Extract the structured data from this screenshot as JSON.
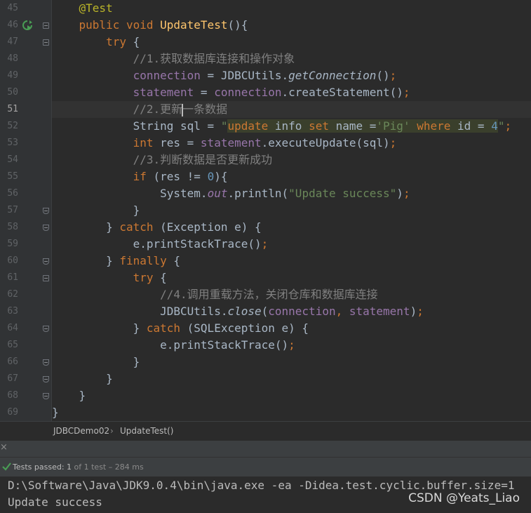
{
  "editor": {
    "current_line": "51",
    "lines": [
      {
        "n": "45",
        "parts": [
          [
            "    ",
            ""
          ],
          [
            "@Test",
            "ann"
          ]
        ]
      },
      {
        "n": "46",
        "parts": [
          [
            "    ",
            ""
          ],
          [
            "public void ",
            "kw"
          ],
          [
            "UpdateTest",
            "fn"
          ],
          [
            "(){",
            ""
          ]
        ]
      },
      {
        "n": "47",
        "parts": [
          [
            "        ",
            ""
          ],
          [
            "try ",
            "kw"
          ],
          [
            "{",
            ""
          ]
        ]
      },
      {
        "n": "48",
        "parts": [
          [
            "            ",
            ""
          ],
          [
            "//1.获取数据库连接和操作对象",
            "cmt"
          ]
        ]
      },
      {
        "n": "49",
        "parts": [
          [
            "            ",
            ""
          ],
          [
            "connection",
            "fld"
          ],
          [
            " = JDBCUtils.",
            ""
          ],
          [
            "getConnection",
            "it"
          ],
          [
            "()",
            ""
          ],
          [
            ";",
            "kw"
          ]
        ]
      },
      {
        "n": "50",
        "parts": [
          [
            "            ",
            ""
          ],
          [
            "statement",
            "fld"
          ],
          [
            " = ",
            ""
          ],
          [
            "connection",
            "fld"
          ],
          [
            ".createStatement()",
            ""
          ],
          [
            ";",
            "kw"
          ]
        ]
      },
      {
        "n": "51",
        "parts": [
          [
            "            ",
            ""
          ],
          [
            "//2.更新",
            "cmt"
          ],
          [
            "",
            "caret"
          ],
          [
            "一条数据",
            "cmt"
          ]
        ]
      },
      {
        "n": "52",
        "parts": [
          [
            "            ",
            ""
          ],
          [
            "String sql = ",
            ""
          ],
          [
            "\"",
            "str"
          ],
          [
            "update",
            "kw hl"
          ],
          [
            " info ",
            "hl"
          ],
          [
            "set",
            "kw hl"
          ],
          [
            " name =",
            "hl"
          ],
          [
            "'Pig'",
            "str hl"
          ],
          [
            " ",
            "hl"
          ],
          [
            "where",
            "kw hl"
          ],
          [
            " id = ",
            "hl"
          ],
          [
            "4",
            "num hl"
          ],
          [
            "\"",
            "str"
          ],
          [
            ";",
            "kw"
          ]
        ]
      },
      {
        "n": "53",
        "parts": [
          [
            "            ",
            ""
          ],
          [
            "int ",
            "kw"
          ],
          [
            "res = ",
            ""
          ],
          [
            "statement",
            "fld"
          ],
          [
            ".executeUpdate(sql)",
            ""
          ],
          [
            ";",
            "kw"
          ]
        ]
      },
      {
        "n": "54",
        "parts": [
          [
            "            ",
            ""
          ],
          [
            "//3.判断数据是否更新成功",
            "cmt"
          ]
        ]
      },
      {
        "n": "55",
        "parts": [
          [
            "            ",
            ""
          ],
          [
            "if ",
            "kw"
          ],
          [
            "(res != ",
            ""
          ],
          [
            "0",
            "num"
          ],
          [
            "){",
            ""
          ]
        ]
      },
      {
        "n": "56",
        "parts": [
          [
            "                ",
            ""
          ],
          [
            "System.",
            ""
          ],
          [
            "out",
            "fld it"
          ],
          [
            ".println(",
            ""
          ],
          [
            "\"Update success\"",
            "str"
          ],
          [
            ")",
            ""
          ],
          [
            ";",
            "kw"
          ]
        ]
      },
      {
        "n": "57",
        "parts": [
          [
            "            ",
            ""
          ],
          [
            "}",
            ""
          ]
        ]
      },
      {
        "n": "58",
        "parts": [
          [
            "        ",
            ""
          ],
          [
            "} ",
            ""
          ],
          [
            "catch ",
            "kw"
          ],
          [
            "(Exception e) {",
            ""
          ]
        ]
      },
      {
        "n": "59",
        "parts": [
          [
            "            ",
            ""
          ],
          [
            "e.printStackTrace()",
            ""
          ],
          [
            ";",
            "kw"
          ]
        ]
      },
      {
        "n": "60",
        "parts": [
          [
            "        ",
            ""
          ],
          [
            "} ",
            ""
          ],
          [
            "finally ",
            "kw"
          ],
          [
            "{",
            ""
          ]
        ]
      },
      {
        "n": "61",
        "parts": [
          [
            "            ",
            ""
          ],
          [
            "try ",
            "kw"
          ],
          [
            "{",
            ""
          ]
        ]
      },
      {
        "n": "62",
        "parts": [
          [
            "                ",
            ""
          ],
          [
            "//4.调用重载方法，关闭仓库和数据库连接",
            "cmt"
          ]
        ]
      },
      {
        "n": "63",
        "parts": [
          [
            "                ",
            ""
          ],
          [
            "JDBCUtils.",
            ""
          ],
          [
            "close",
            "it"
          ],
          [
            "(",
            ""
          ],
          [
            "connection",
            "fld"
          ],
          [
            ", ",
            "kw"
          ],
          [
            "statement",
            "fld"
          ],
          [
            ")",
            ""
          ],
          [
            ";",
            "kw"
          ]
        ]
      },
      {
        "n": "64",
        "parts": [
          [
            "            ",
            ""
          ],
          [
            "} ",
            ""
          ],
          [
            "catch ",
            "kw"
          ],
          [
            "(SQLException e) {",
            ""
          ]
        ]
      },
      {
        "n": "65",
        "parts": [
          [
            "                ",
            ""
          ],
          [
            "e.printStackTrace()",
            ""
          ],
          [
            ";",
            "kw"
          ]
        ]
      },
      {
        "n": "66",
        "parts": [
          [
            "            ",
            ""
          ],
          [
            "}",
            ""
          ]
        ]
      },
      {
        "n": "67",
        "parts": [
          [
            "        ",
            ""
          ],
          [
            "}",
            ""
          ]
        ]
      },
      {
        "n": "68",
        "parts": [
          [
            "    ",
            ""
          ],
          [
            "}",
            ""
          ]
        ]
      },
      {
        "n": "69",
        "parts": [
          [
            "",
            ""
          ],
          [
            "}",
            ""
          ]
        ]
      }
    ]
  },
  "breadcrumb": {
    "class_name": "JDBCDemo02",
    "separator": "›",
    "method_name": "UpdateTest()"
  },
  "run_panel": {
    "close_glyph": "×",
    "status_label": "Tests passed: ",
    "status_count": "1",
    "status_rest": " of 1 test – 284 ms"
  },
  "console": {
    "line1": "D:\\Software\\Java\\JDK9.0.4\\bin\\java.exe -ea -Didea.test.cyclic.buffer.size=1",
    "line2": "Update success"
  },
  "watermark": "CSDN @Yeats_Liao",
  "colors": {
    "keyword": "#cc7832",
    "string": "#6a8759",
    "comment": "#808080",
    "field": "#9876aa",
    "method": "#ffc66d",
    "annotation": "#bbb529",
    "number": "#6897bb",
    "pass_green": "#499c54"
  }
}
